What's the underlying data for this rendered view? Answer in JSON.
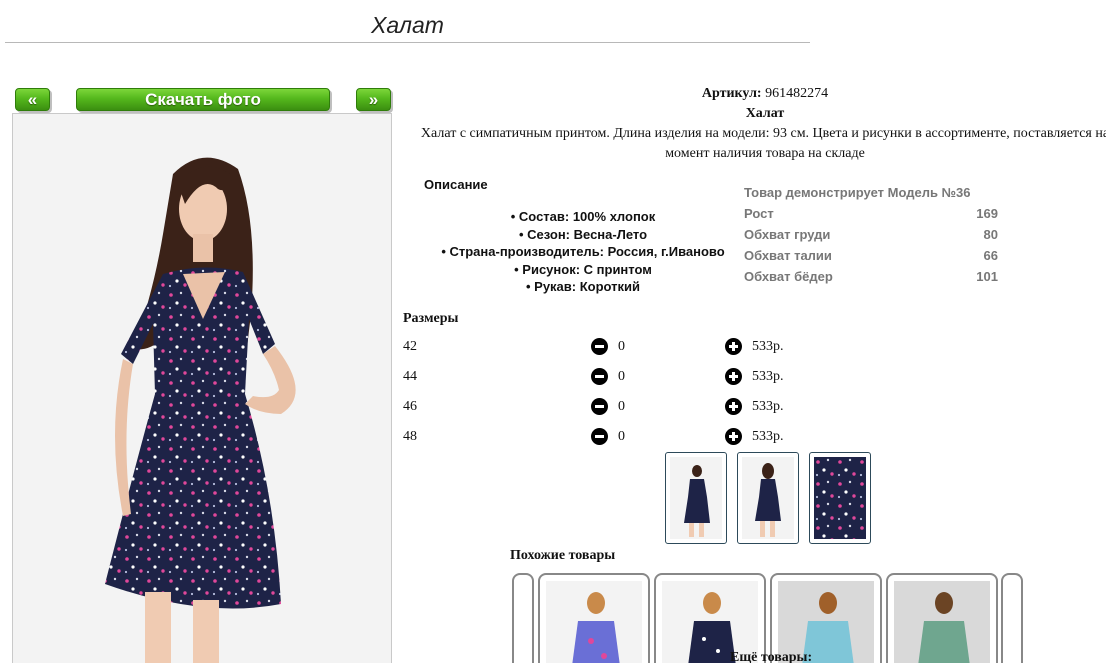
{
  "page": {
    "title": "Халат"
  },
  "buttons": {
    "prev": "«",
    "download": "Скачать фото",
    "next": "»"
  },
  "product": {
    "sku_label": "Артикул:",
    "sku": "961482274",
    "name": "Халат",
    "description": "Халат с симпатичным принтом. Длина изделия на модели: 93 см. Цвета и рисунки в ассортименте, поставляется на момент наличия товара на складе"
  },
  "details": {
    "heading": "Описание",
    "features": [
      "• Состав: 100% хлопок",
      "• Сезон: Весна-Лето",
      "• Страна-производитель: Россия, г.Иваново",
      "• Рисунок: С принтом",
      "• Рукав: Короткий"
    ]
  },
  "model": {
    "heading": "Товар демонстрирует Модель №36",
    "rows": [
      {
        "label": "Рост",
        "value": "169"
      },
      {
        "label": "Обхват груди",
        "value": "80"
      },
      {
        "label": "Обхват талии",
        "value": "66"
      },
      {
        "label": "Обхват бёдер",
        "value": "101"
      }
    ]
  },
  "sizes": {
    "heading": "Размеры",
    "rows": [
      {
        "size": "42",
        "qty": "0",
        "price": "533р."
      },
      {
        "size": "44",
        "qty": "0",
        "price": "533р."
      },
      {
        "size": "46",
        "qty": "0",
        "price": "533р."
      },
      {
        "size": "48",
        "qty": "0",
        "price": "533р."
      }
    ]
  },
  "similar": {
    "heading": "Похожие товары"
  },
  "more": {
    "heading": "Ещё товары:"
  },
  "colors": {
    "accent_green": "#55b81d",
    "dress_navy": "#1e2347",
    "print_pink": "#e0479a"
  }
}
